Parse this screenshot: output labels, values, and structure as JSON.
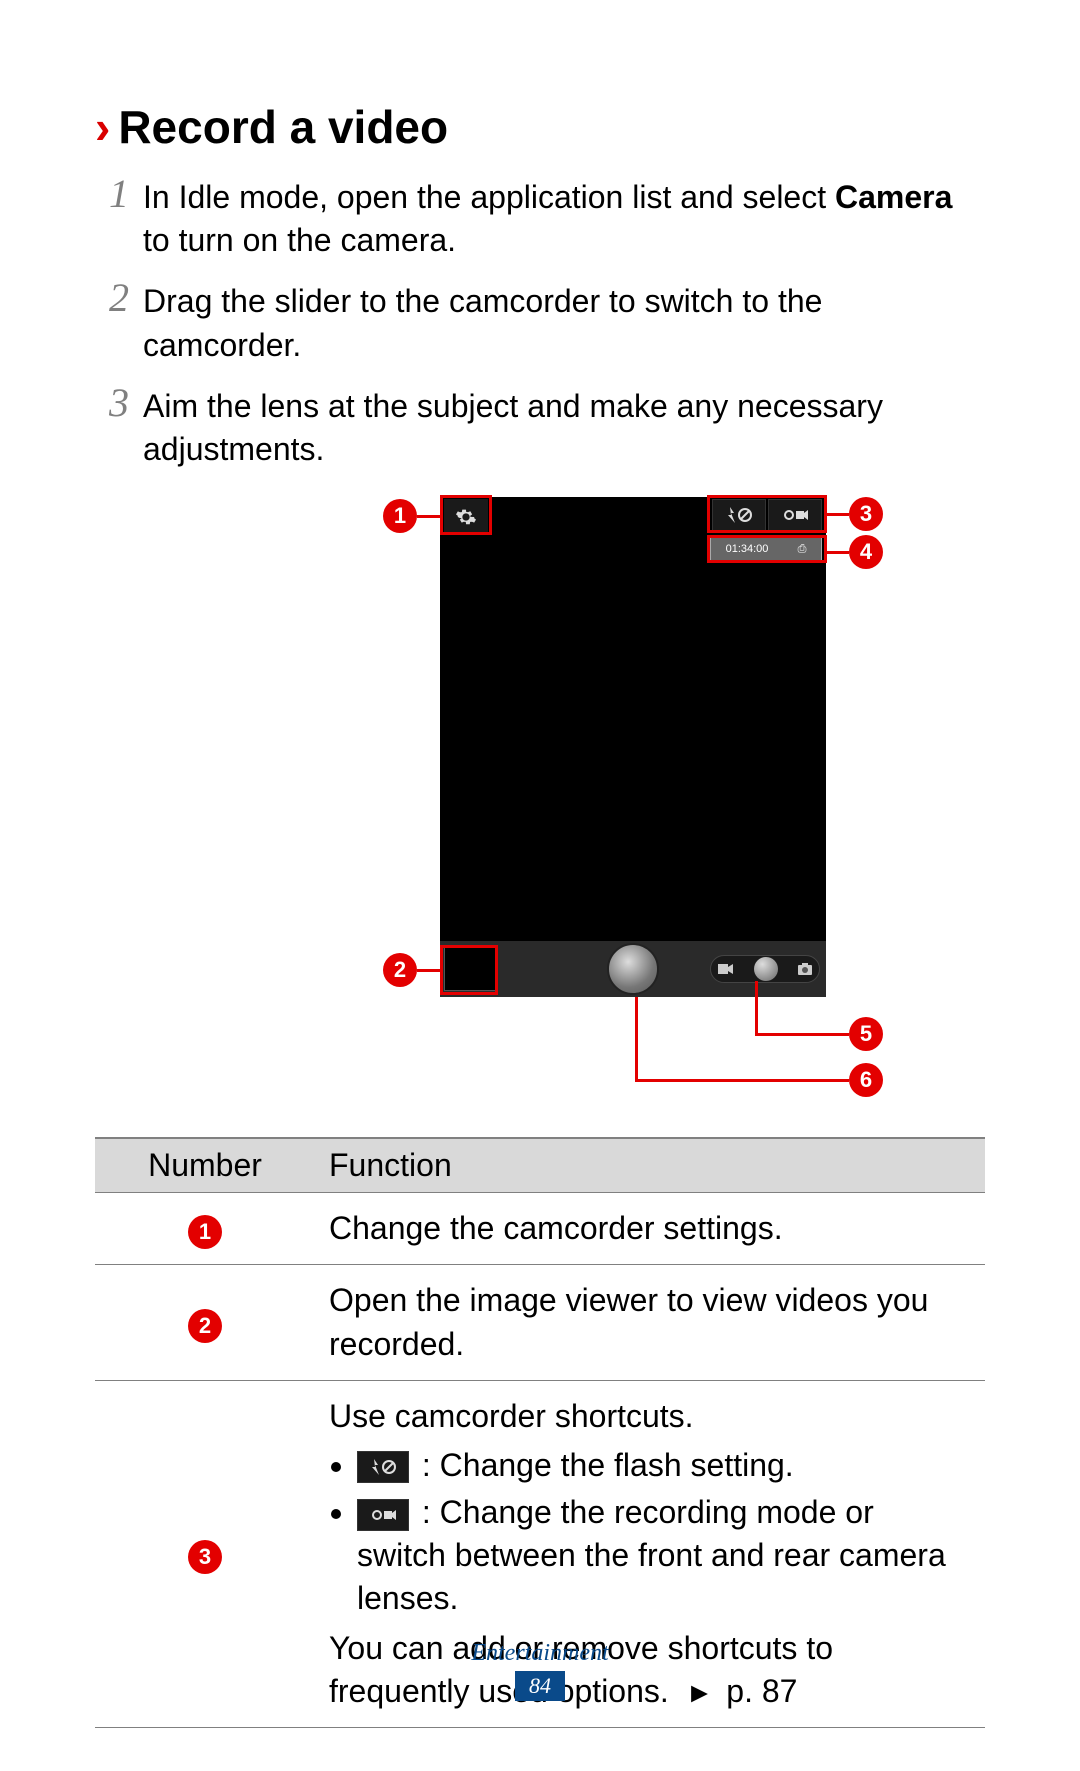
{
  "heading": {
    "chevron": "›",
    "title": "Record a video"
  },
  "steps": [
    {
      "num": "1",
      "prefix": "In Idle mode, open the application list and select ",
      "bold": "Camera",
      "suffix": " to turn on the camera."
    },
    {
      "num": "2",
      "prefix": "Drag the slider to the camcorder to switch to the camcorder.",
      "bold": "",
      "suffix": ""
    },
    {
      "num": "3",
      "prefix": "Aim the lens at the subject and make any necessary adjustments.",
      "bold": "",
      "suffix": ""
    }
  ],
  "diagram": {
    "callouts": [
      "1",
      "2",
      "3",
      "4",
      "5",
      "6"
    ],
    "timer": "01:34:00",
    "storage_glyph": "⎙"
  },
  "table": {
    "headers": {
      "number": "Number",
      "function": "Function"
    },
    "row1": {
      "num": "1",
      "text": "Change the camcorder settings."
    },
    "row2": {
      "num": "2",
      "text": "Open the image viewer to view videos you recorded."
    },
    "row3": {
      "num": "3",
      "intro": "Use camcorder shortcuts.",
      "bullet1_after": " : Change the flash setting.",
      "bullet2_after": " : Change the recording mode or switch between the front and rear camera lenses.",
      "outro_prefix": "You can add or remove shortcuts to frequently used options. ",
      "outro_arrow": "►",
      "outro_page": " p. 87"
    }
  },
  "footer": {
    "category": "Entertainment",
    "page": "84"
  }
}
